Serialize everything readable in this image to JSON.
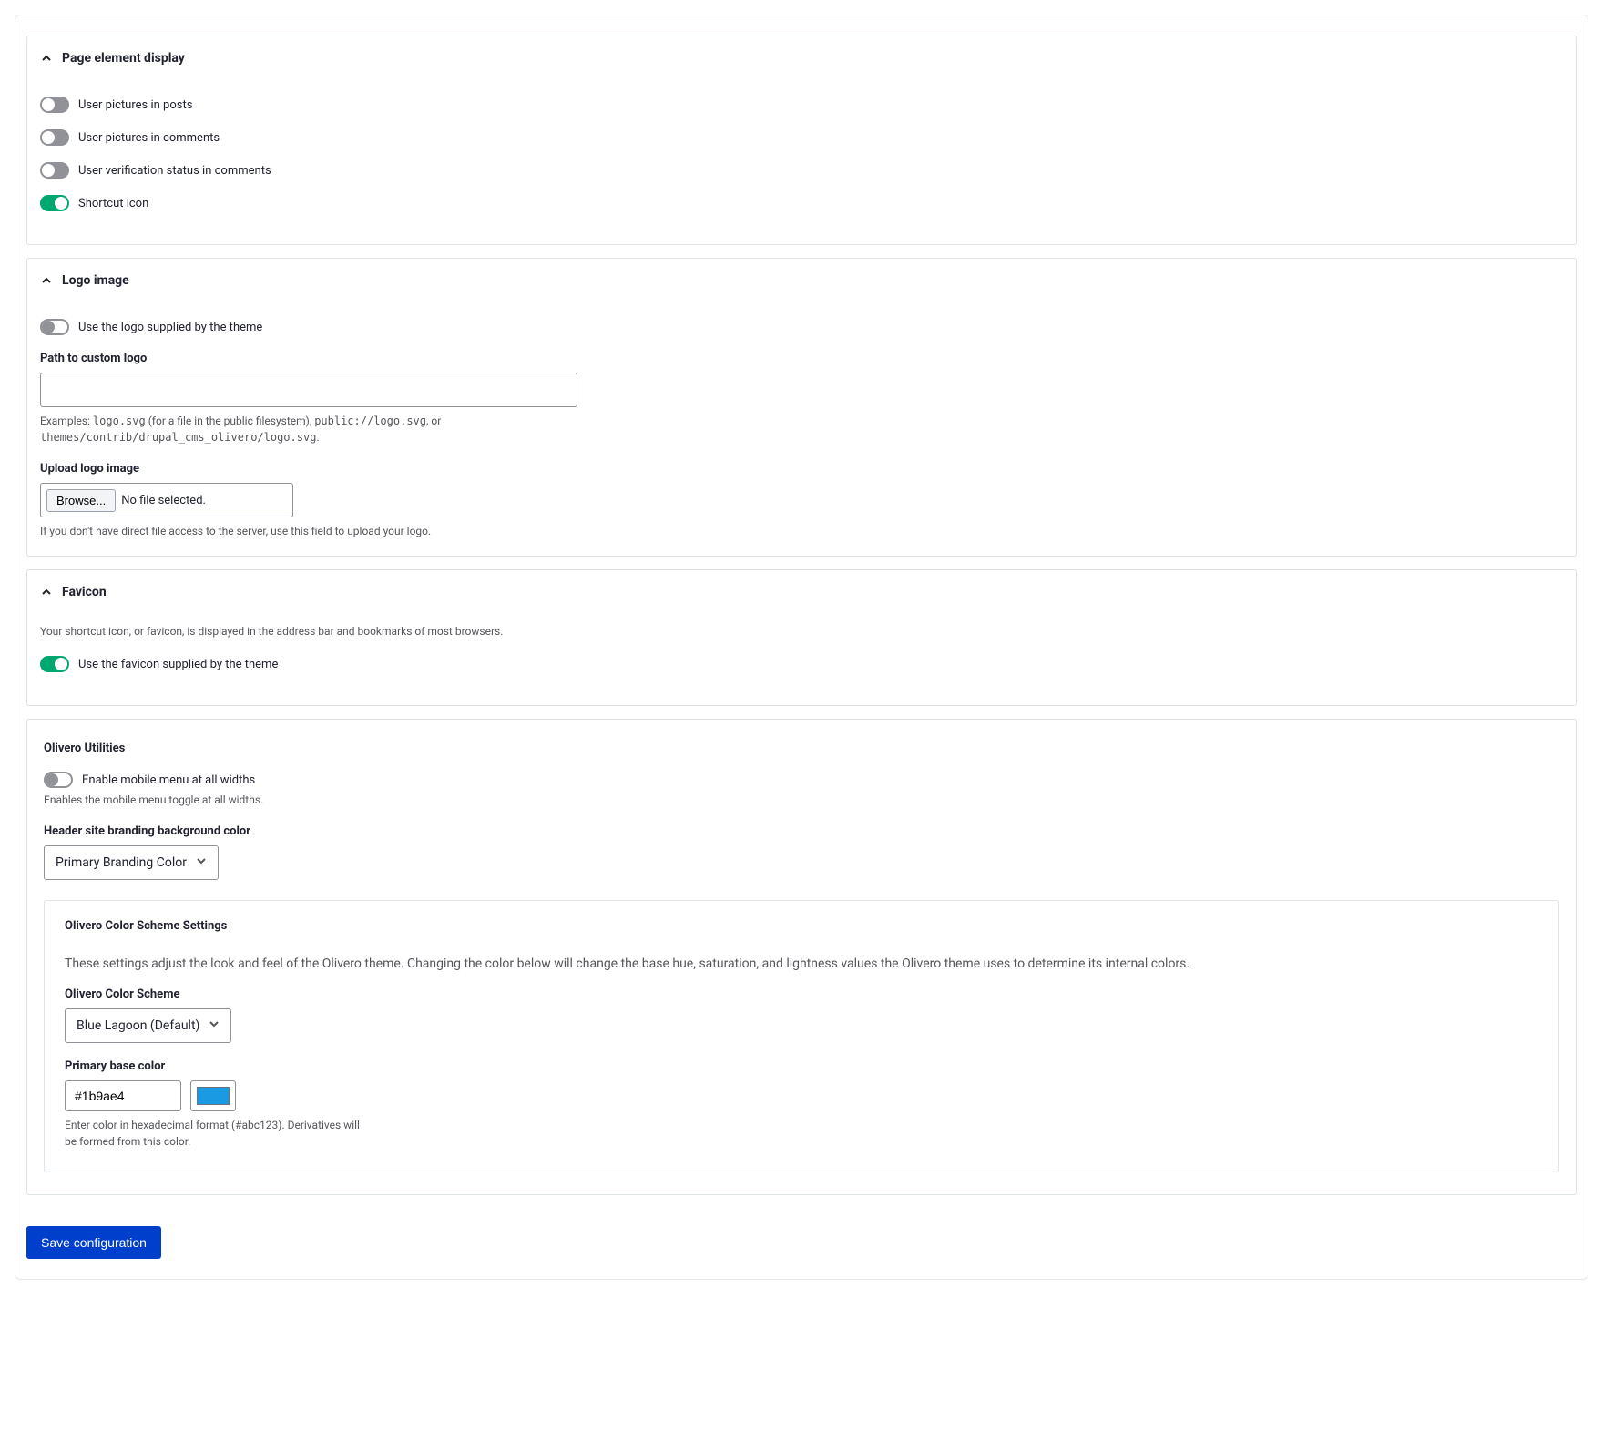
{
  "page_element_display": {
    "title": "Page element display",
    "toggles": [
      {
        "label": "User pictures in posts",
        "on": false
      },
      {
        "label": "User pictures in comments",
        "on": false
      },
      {
        "label": "User verification status in comments",
        "on": false
      },
      {
        "label": "Shortcut icon",
        "on": true
      }
    ]
  },
  "logo_image": {
    "title": "Logo image",
    "use_theme_logo": {
      "label": "Use the logo supplied by the theme",
      "on": false
    },
    "path_label": "Path to custom logo",
    "path_value": "",
    "path_desc_prefix": "Examples: ",
    "path_code_1": "logo.svg",
    "path_desc_mid1": " (for a file in the public filesystem), ",
    "path_code_2": "public://logo.svg",
    "path_desc_mid2": ", or ",
    "path_code_3": "themes/contrib/drupal_cms_olivero/logo.svg",
    "path_desc_suffix": ".",
    "upload_label": "Upload logo image",
    "browse_label": "Browse...",
    "file_status": "No file selected.",
    "upload_desc": "If you don't have direct file access to the server, use this field to upload your logo."
  },
  "favicon": {
    "title": "Favicon",
    "desc": "Your shortcut icon, or favicon, is displayed in the address bar and bookmarks of most browsers.",
    "use_theme": {
      "label": "Use the favicon supplied by the theme",
      "on": true
    }
  },
  "olivero": {
    "title": "Olivero Utilities",
    "mobile_menu": {
      "label": "Enable mobile menu at all widths",
      "on": false
    },
    "mobile_menu_desc": "Enables the mobile menu toggle at all widths.",
    "branding_label": "Header site branding background color",
    "branding_value": "Primary Branding Color",
    "color_panel": {
      "title": "Olivero Color Scheme Settings",
      "desc": "These settings adjust the look and feel of the Olivero theme. Changing the color below will change the base hue, saturation, and lightness values the Olivero theme uses to determine its internal colors.",
      "scheme_label": "Olivero Color Scheme",
      "scheme_value": "Blue Lagoon (Default)",
      "primary_label": "Primary base color",
      "primary_value": "#1b9ae4",
      "primary_desc": "Enter color in hexadecimal format (#abc123). Derivatives will be formed from this color."
    }
  },
  "save_label": "Save configuration"
}
